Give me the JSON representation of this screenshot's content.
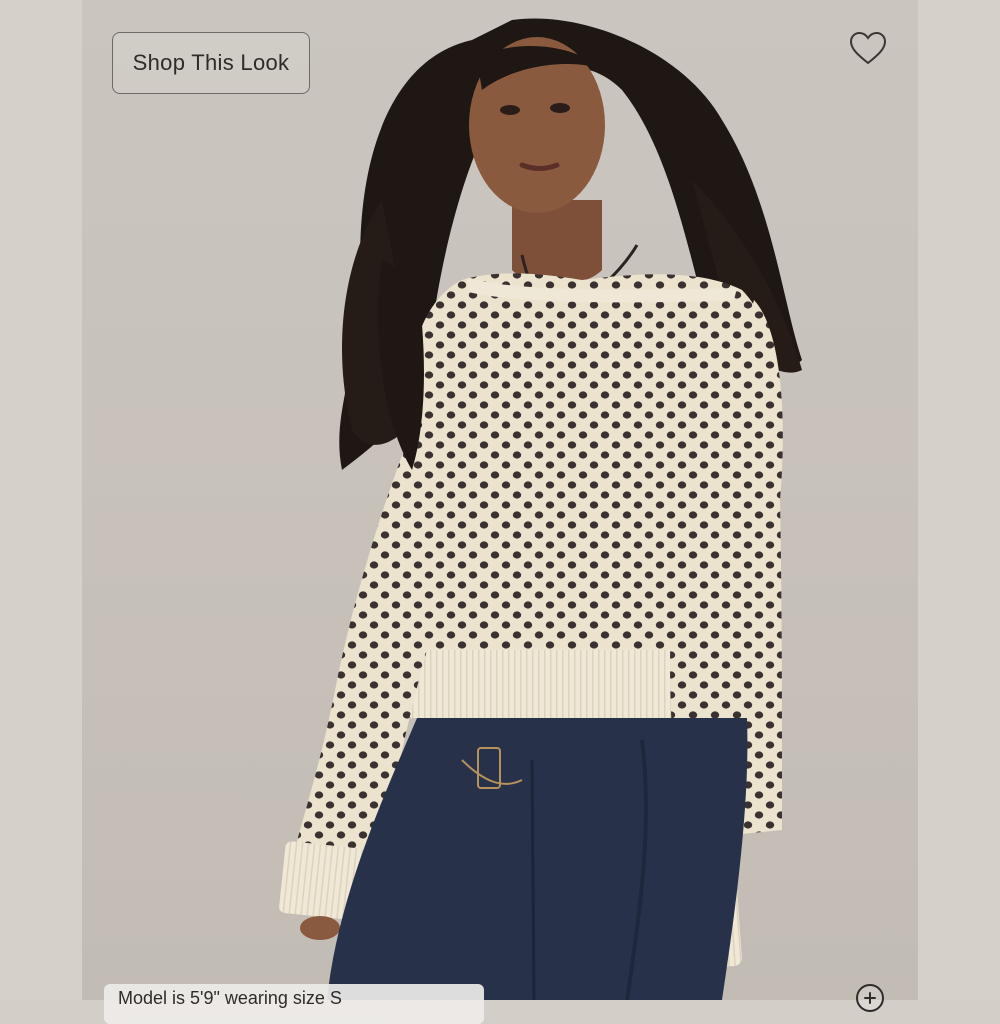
{
  "shop_look": {
    "label": "Shop This Look"
  },
  "favorite": {
    "icon": "heart-outline-icon"
  },
  "caption": {
    "text": "Model is 5'9\" wearing size S"
  },
  "zoom": {
    "icon": "zoom-in-icon"
  },
  "colors": {
    "backdrop": "#c7c1ba",
    "sweater": "#ece4cf",
    "denim": "#27324a",
    "hair": "#1f1714",
    "skin": "#8a5a3f"
  }
}
